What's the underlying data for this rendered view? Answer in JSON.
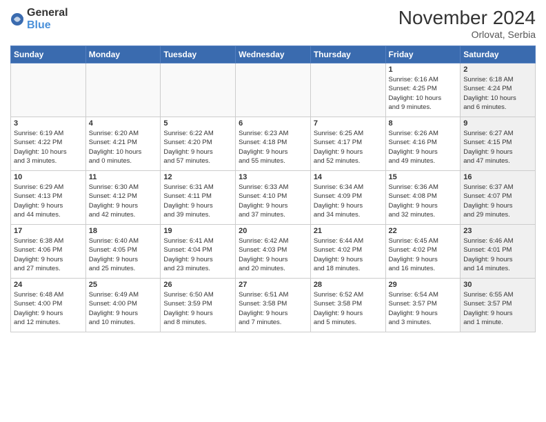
{
  "logo": {
    "general": "General",
    "blue": "Blue"
  },
  "header": {
    "month": "November 2024",
    "location": "Orlovat, Serbia"
  },
  "days_of_week": [
    "Sunday",
    "Monday",
    "Tuesday",
    "Wednesday",
    "Thursday",
    "Friday",
    "Saturday"
  ],
  "weeks": [
    [
      {
        "day": "",
        "info": "",
        "shaded": false,
        "empty": true
      },
      {
        "day": "",
        "info": "",
        "shaded": false,
        "empty": true
      },
      {
        "day": "",
        "info": "",
        "shaded": false,
        "empty": true
      },
      {
        "day": "",
        "info": "",
        "shaded": false,
        "empty": true
      },
      {
        "day": "",
        "info": "",
        "shaded": false,
        "empty": true
      },
      {
        "day": "1",
        "info": "Sunrise: 6:16 AM\nSunset: 4:25 PM\nDaylight: 10 hours\nand 9 minutes.",
        "shaded": false,
        "empty": false
      },
      {
        "day": "2",
        "info": "Sunrise: 6:18 AM\nSunset: 4:24 PM\nDaylight: 10 hours\nand 6 minutes.",
        "shaded": true,
        "empty": false
      }
    ],
    [
      {
        "day": "3",
        "info": "Sunrise: 6:19 AM\nSunset: 4:22 PM\nDaylight: 10 hours\nand 3 minutes.",
        "shaded": false,
        "empty": false
      },
      {
        "day": "4",
        "info": "Sunrise: 6:20 AM\nSunset: 4:21 PM\nDaylight: 10 hours\nand 0 minutes.",
        "shaded": false,
        "empty": false
      },
      {
        "day": "5",
        "info": "Sunrise: 6:22 AM\nSunset: 4:20 PM\nDaylight: 9 hours\nand 57 minutes.",
        "shaded": false,
        "empty": false
      },
      {
        "day": "6",
        "info": "Sunrise: 6:23 AM\nSunset: 4:18 PM\nDaylight: 9 hours\nand 55 minutes.",
        "shaded": false,
        "empty": false
      },
      {
        "day": "7",
        "info": "Sunrise: 6:25 AM\nSunset: 4:17 PM\nDaylight: 9 hours\nand 52 minutes.",
        "shaded": false,
        "empty": false
      },
      {
        "day": "8",
        "info": "Sunrise: 6:26 AM\nSunset: 4:16 PM\nDaylight: 9 hours\nand 49 minutes.",
        "shaded": false,
        "empty": false
      },
      {
        "day": "9",
        "info": "Sunrise: 6:27 AM\nSunset: 4:15 PM\nDaylight: 9 hours\nand 47 minutes.",
        "shaded": true,
        "empty": false
      }
    ],
    [
      {
        "day": "10",
        "info": "Sunrise: 6:29 AM\nSunset: 4:13 PM\nDaylight: 9 hours\nand 44 minutes.",
        "shaded": false,
        "empty": false
      },
      {
        "day": "11",
        "info": "Sunrise: 6:30 AM\nSunset: 4:12 PM\nDaylight: 9 hours\nand 42 minutes.",
        "shaded": false,
        "empty": false
      },
      {
        "day": "12",
        "info": "Sunrise: 6:31 AM\nSunset: 4:11 PM\nDaylight: 9 hours\nand 39 minutes.",
        "shaded": false,
        "empty": false
      },
      {
        "day": "13",
        "info": "Sunrise: 6:33 AM\nSunset: 4:10 PM\nDaylight: 9 hours\nand 37 minutes.",
        "shaded": false,
        "empty": false
      },
      {
        "day": "14",
        "info": "Sunrise: 6:34 AM\nSunset: 4:09 PM\nDaylight: 9 hours\nand 34 minutes.",
        "shaded": false,
        "empty": false
      },
      {
        "day": "15",
        "info": "Sunrise: 6:36 AM\nSunset: 4:08 PM\nDaylight: 9 hours\nand 32 minutes.",
        "shaded": false,
        "empty": false
      },
      {
        "day": "16",
        "info": "Sunrise: 6:37 AM\nSunset: 4:07 PM\nDaylight: 9 hours\nand 29 minutes.",
        "shaded": true,
        "empty": false
      }
    ],
    [
      {
        "day": "17",
        "info": "Sunrise: 6:38 AM\nSunset: 4:06 PM\nDaylight: 9 hours\nand 27 minutes.",
        "shaded": false,
        "empty": false
      },
      {
        "day": "18",
        "info": "Sunrise: 6:40 AM\nSunset: 4:05 PM\nDaylight: 9 hours\nand 25 minutes.",
        "shaded": false,
        "empty": false
      },
      {
        "day": "19",
        "info": "Sunrise: 6:41 AM\nSunset: 4:04 PM\nDaylight: 9 hours\nand 23 minutes.",
        "shaded": false,
        "empty": false
      },
      {
        "day": "20",
        "info": "Sunrise: 6:42 AM\nSunset: 4:03 PM\nDaylight: 9 hours\nand 20 minutes.",
        "shaded": false,
        "empty": false
      },
      {
        "day": "21",
        "info": "Sunrise: 6:44 AM\nSunset: 4:02 PM\nDaylight: 9 hours\nand 18 minutes.",
        "shaded": false,
        "empty": false
      },
      {
        "day": "22",
        "info": "Sunrise: 6:45 AM\nSunset: 4:02 PM\nDaylight: 9 hours\nand 16 minutes.",
        "shaded": false,
        "empty": false
      },
      {
        "day": "23",
        "info": "Sunrise: 6:46 AM\nSunset: 4:01 PM\nDaylight: 9 hours\nand 14 minutes.",
        "shaded": true,
        "empty": false
      }
    ],
    [
      {
        "day": "24",
        "info": "Sunrise: 6:48 AM\nSunset: 4:00 PM\nDaylight: 9 hours\nand 12 minutes.",
        "shaded": false,
        "empty": false
      },
      {
        "day": "25",
        "info": "Sunrise: 6:49 AM\nSunset: 4:00 PM\nDaylight: 9 hours\nand 10 minutes.",
        "shaded": false,
        "empty": false
      },
      {
        "day": "26",
        "info": "Sunrise: 6:50 AM\nSunset: 3:59 PM\nDaylight: 9 hours\nand 8 minutes.",
        "shaded": false,
        "empty": false
      },
      {
        "day": "27",
        "info": "Sunrise: 6:51 AM\nSunset: 3:58 PM\nDaylight: 9 hours\nand 7 minutes.",
        "shaded": false,
        "empty": false
      },
      {
        "day": "28",
        "info": "Sunrise: 6:52 AM\nSunset: 3:58 PM\nDaylight: 9 hours\nand 5 minutes.",
        "shaded": false,
        "empty": false
      },
      {
        "day": "29",
        "info": "Sunrise: 6:54 AM\nSunset: 3:57 PM\nDaylight: 9 hours\nand 3 minutes.",
        "shaded": false,
        "empty": false
      },
      {
        "day": "30",
        "info": "Sunrise: 6:55 AM\nSunset: 3:57 PM\nDaylight: 9 hours\nand 1 minute.",
        "shaded": true,
        "empty": false
      }
    ]
  ]
}
